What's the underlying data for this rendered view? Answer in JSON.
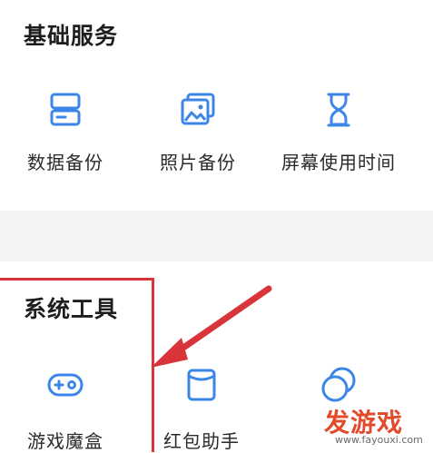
{
  "colors": {
    "icon_blue": "#3b86e6",
    "highlight_red": "#d9343a",
    "divider": "#f4f4f6"
  },
  "basic_services": {
    "title": "基础服务",
    "items": [
      {
        "label": "数据备份",
        "icon": "database-backup-icon"
      },
      {
        "label": "照片备份",
        "icon": "photo-backup-icon"
      },
      {
        "label": "屏幕使用时间",
        "icon": "hourglass-icon"
      }
    ]
  },
  "system_tools": {
    "title": "系统工具",
    "items": [
      {
        "label": "游戏魔盒",
        "icon": "gamepad-icon"
      },
      {
        "label": "红包助手",
        "icon": "red-packet-icon"
      },
      {
        "label": "",
        "icon": "multi-window-icon"
      }
    ]
  },
  "watermark": {
    "title": "发游戏",
    "url": "www.fayouxi.com"
  }
}
